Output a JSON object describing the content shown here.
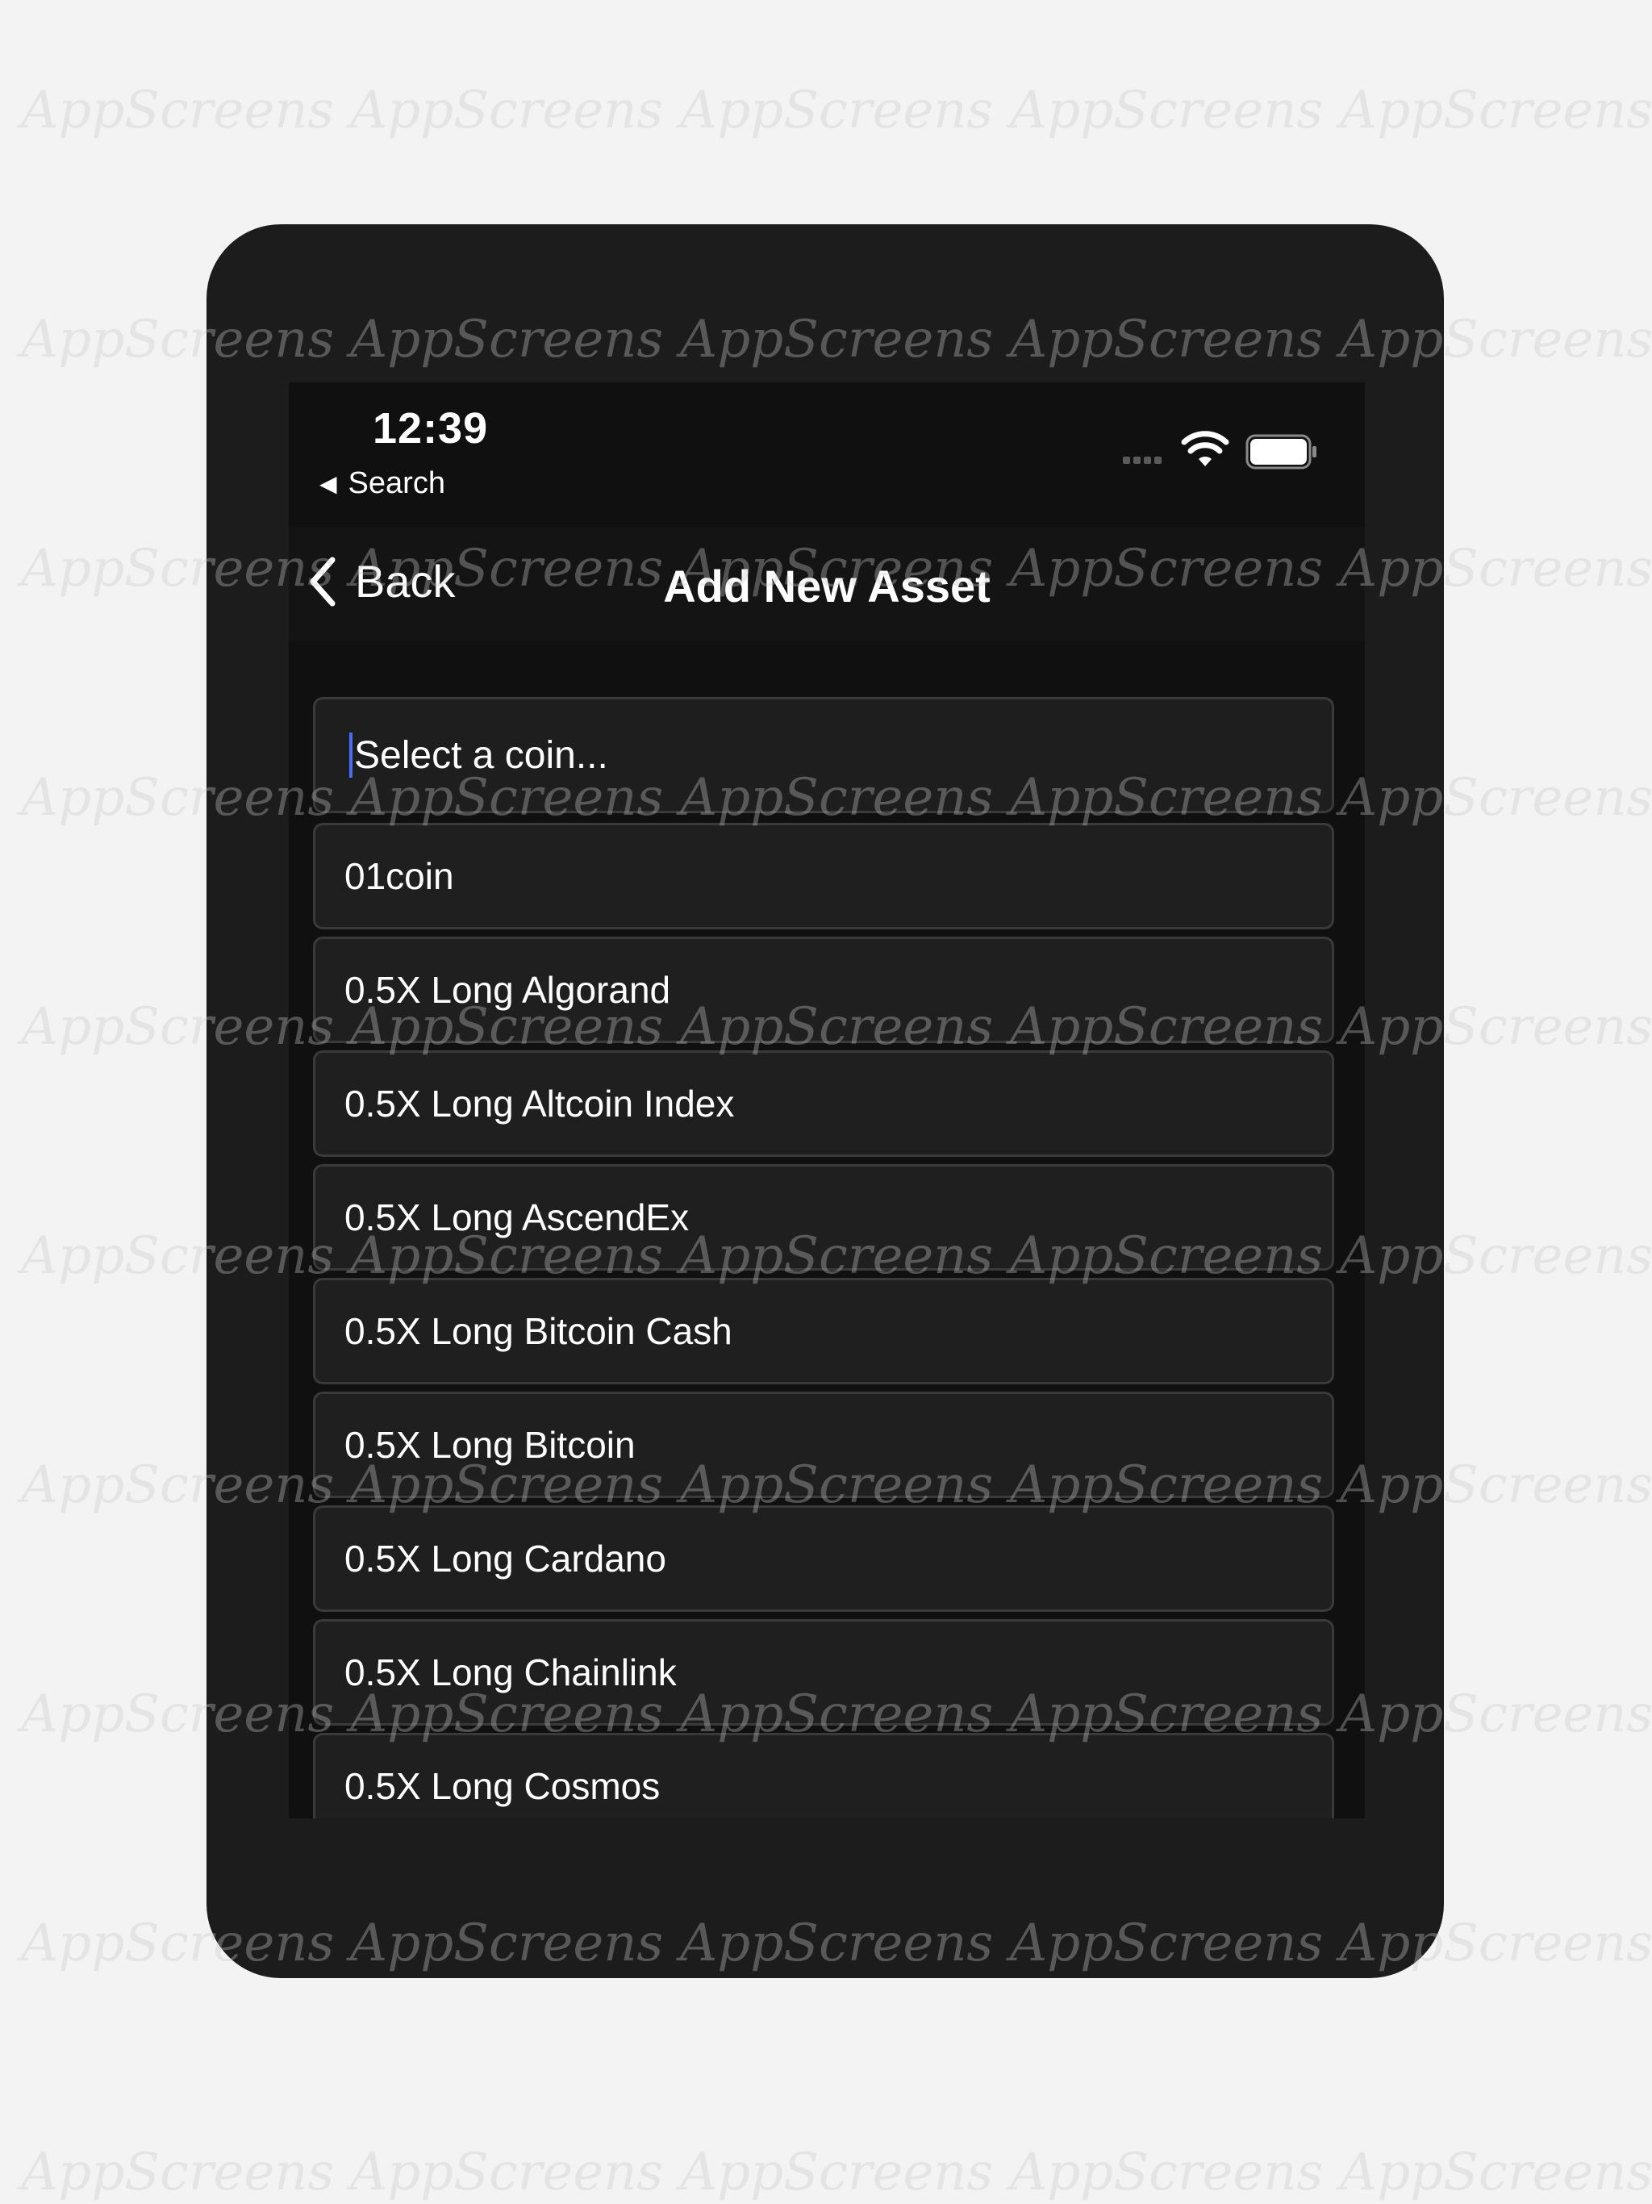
{
  "status_bar": {
    "time": "12:39",
    "back_to_app": "Search",
    "back_arrow_icon": "triangle-left-icon",
    "icons": [
      "cellular-signal-icon",
      "wifi-icon",
      "battery-icon"
    ]
  },
  "nav": {
    "back_label": "Back",
    "back_icon": "chevron-left-icon",
    "title": "Add New Asset"
  },
  "search": {
    "placeholder": "Select a coin..."
  },
  "coins": [
    "01coin",
    "0.5X Long Algorand",
    "0.5X Long Altcoin Index",
    "0.5X Long AscendEx",
    "0.5X Long Bitcoin Cash",
    "0.5X Long Bitcoin",
    "0.5X Long Cardano",
    "0.5X Long Chainlink",
    "0.5X Long Cosmos"
  ],
  "watermark": "AppScreens",
  "colors": {
    "background": "#f3f3f3",
    "device": "#1c1c1c",
    "screen": "#101010",
    "list_item": "#1f1f1f",
    "caret": "#4a6cf7"
  }
}
